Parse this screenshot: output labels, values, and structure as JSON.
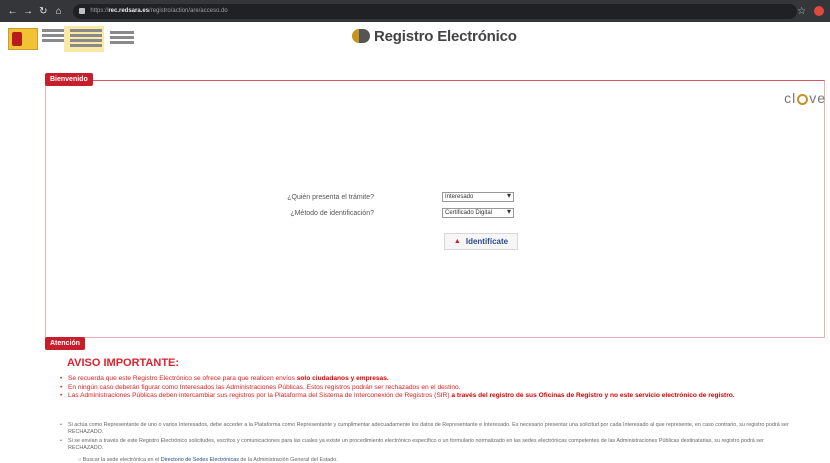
{
  "browser": {
    "url_host": "rec.redsara.es",
    "url_path": "/registro/action/are/acceso.do"
  },
  "header": {
    "title": "Registro Electrónico"
  },
  "welcome": {
    "tab_label": "Bienvenido",
    "clave_logo": "cl@ve",
    "question_who": "¿Quién presenta el trámite?",
    "who_value": "Interesado",
    "question_method": "¿Método de identificación?",
    "method_value": "Certificado Digital",
    "identify_label": "Identifícate"
  },
  "attention": {
    "tab_label": "Atención",
    "title": "AVISO IMPORTANTE:",
    "notes": [
      {
        "pre": "Se recuerda que este Registro Electrónico se ofrece para que realicen envíos ",
        "bold": "solo ciudadanos y empresas.",
        "post": ""
      },
      {
        "pre": "En ningún caso deberán figurar como Interesados las Administraciones Públicas. Estos registros podrán ser rechazados en el destino.",
        "bold": "",
        "post": ""
      },
      {
        "pre": "Las Administraciones Públicas deben intercambiar sus registros por la Plataforma del Sistema de Interconexión de Registros (SIR) ",
        "bold": "a través del registro de sus Oficinas de Registro y no este servicio electrónico de registro.",
        "post": ""
      }
    ],
    "info": [
      "Si actúa como Representante de uno o varios Interesados, debe acceder a la Plataforma como Representante y cumplimentar adecuadamente los datos de Representante e Interesado. Es necesario presentar una solicitud por cada Interesado al que represente, en caso contrario, su registro podrá ser RECHAZADO.",
      "Si se envían a través de este Registro Electrónico solicitudes, escritos y comunicaciones para las cuales ya existe un procedimiento electrónico específico o un formulario normalizado en las sedes electrónicas competentes de las Administraciones Públicas destinatarias, su registro podrá ser RECHAZADO."
    ],
    "sub_pre": "Buscar la sede electrónica en el ",
    "sub_link": "Directorio de Sedes Electrónicas",
    "sub_post": " de la Administración General del Estado."
  }
}
